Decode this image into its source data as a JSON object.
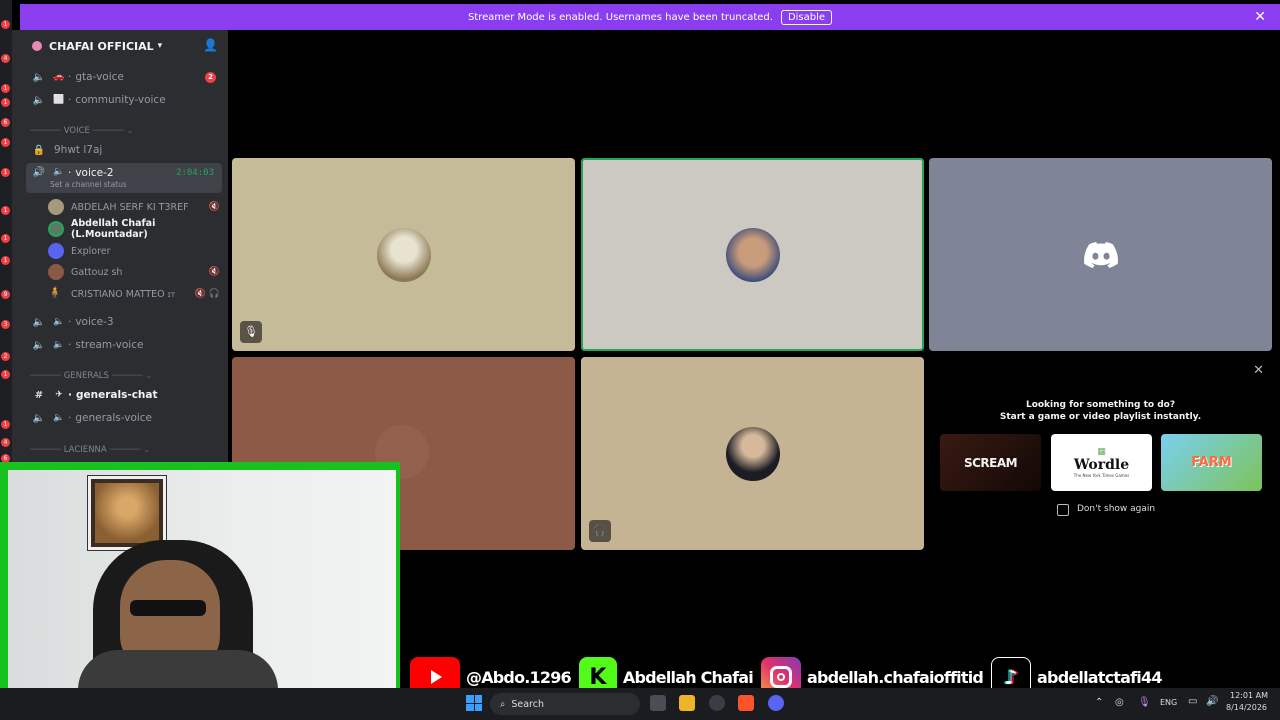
{
  "banner": {
    "text": "Streamer Mode is enabled. Usernames have been truncated.",
    "button": "Disable",
    "close": "✕"
  },
  "server": {
    "name": "CHAFAI OFFICIAL"
  },
  "strip_badges": [
    "1",
    "4",
    "1",
    "1",
    "6",
    "1",
    "1",
    "1",
    "1",
    "1",
    "9",
    "3",
    "2",
    "1",
    "1",
    "4",
    "6"
  ],
  "channels": {
    "gta_voice": {
      "name": "gta-voice",
      "badge": "2"
    },
    "community_voice": {
      "name": "community-voice"
    },
    "voice_category": "VOICE",
    "locked": {
      "name": "9hwt l7aj"
    },
    "voice2": {
      "name": "voice-2",
      "timer": "2:04:03",
      "status": "Set a channel status"
    },
    "voice3": {
      "name": "voice-3"
    },
    "stream_voice": {
      "name": "stream-voice"
    },
    "generals_category": "GENERALS",
    "generals_chat": {
      "name": "generals-chat"
    },
    "generals_voice": {
      "name": "generals-voice"
    },
    "lacienna_category": "LACIENNA"
  },
  "users": [
    {
      "name": "ABDELAH SERF KI T3REF",
      "muted": "🔇"
    },
    {
      "name": "Abdellah Chafai (L.Mountadar)"
    },
    {
      "name": "Explorer"
    },
    {
      "name": "Gattouz sh",
      "muted": "🔇"
    },
    {
      "name": "CRISTIANO MATTEO",
      "prefix": "🧍",
      "tag": "ɪᴛ",
      "muted": "🔇 🎧"
    }
  ],
  "activity": {
    "title1": "Looking for something to do?",
    "title2": "Start a game or video playlist instantly.",
    "games": [
      {
        "label": "SCREAM",
        "color": "#2a1410"
      },
      {
        "label": "Wordle",
        "color": "#ffffff",
        "sub": "The New York Times Games"
      },
      {
        "label": "FARM",
        "color": "#6cc3e6"
      }
    ],
    "dont_show": "Don't show again",
    "close": "✕"
  },
  "social": {
    "youtube": "@Abdo.1296",
    "kick": "Abdellah Chafai",
    "instagram": "abdellah.chafaioffitid",
    "tiktok": "abdellatctafi44"
  },
  "taskbar": {
    "search": "Search",
    "lang": "ENG",
    "time": "12:01 AM",
    "date": "8/14/2026"
  },
  "colors": {
    "banner": "#8a3ef0",
    "speaking": "#23a559",
    "sidebar": "#2b2d31",
    "webcam_border": "#18c21e"
  }
}
